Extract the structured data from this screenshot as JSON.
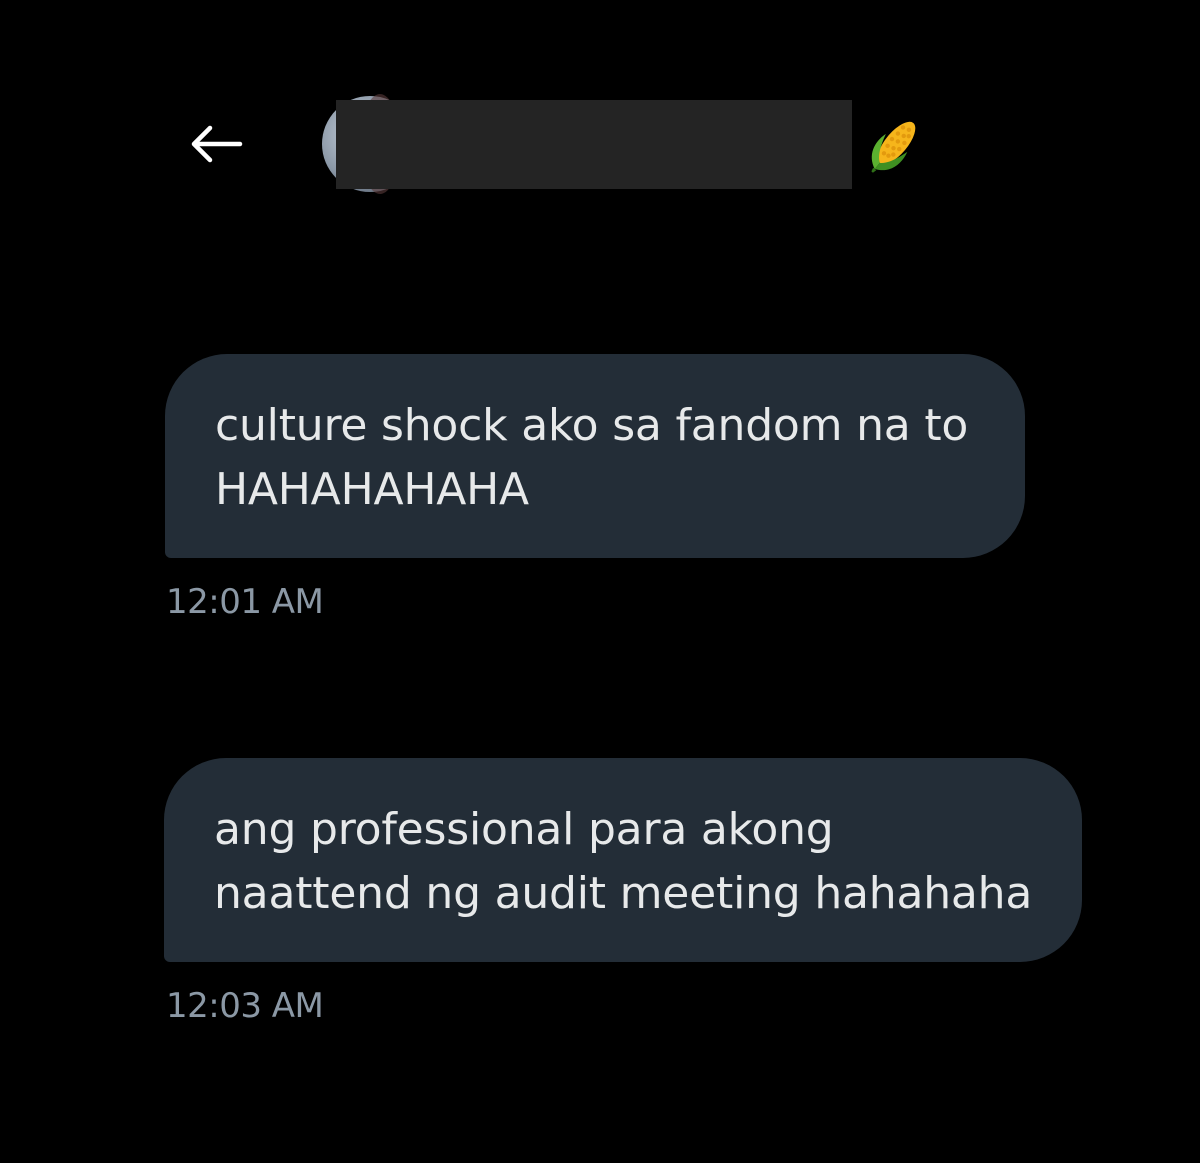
{
  "header": {
    "back_icon": "arrow-left-icon",
    "avatar_icon": "user-avatar",
    "name_emoji": "corn-icon",
    "name_redacted": true
  },
  "messages": [
    {
      "lines": [
        "culture shock ako sa fandom na to",
        "HAHAHAHAHA"
      ],
      "time": "12:01 AM"
    },
    {
      "lines": [
        "ang professional para akong",
        "naattend ng audit meeting hahahaha"
      ],
      "time": "12:03 AM"
    }
  ],
  "colors": {
    "background": "#000000",
    "bubble": "#232d37",
    "text": "#e7e9ea",
    "timestamp": "#8b98a5",
    "redaction": "#242424"
  }
}
